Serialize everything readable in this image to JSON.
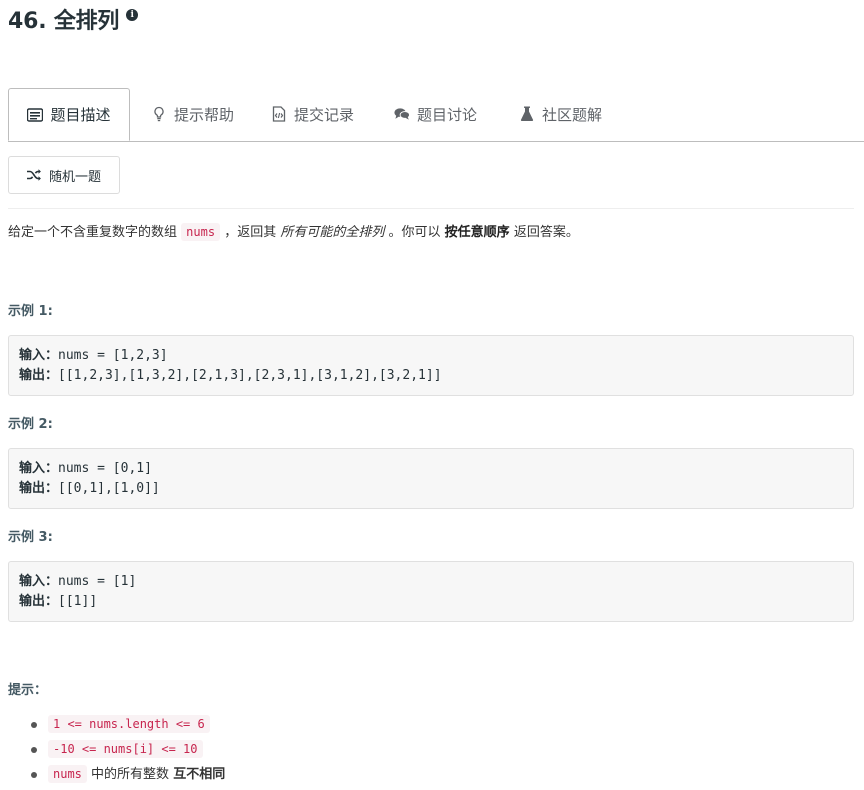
{
  "problem": {
    "title": "46. 全排列",
    "info_icon": "info-icon"
  },
  "tabs": [
    {
      "label": "题目描述",
      "icon": "description-icon",
      "active": true
    },
    {
      "label": "提示帮助",
      "icon": "lightbulb-icon",
      "active": false
    },
    {
      "label": "提交记录",
      "icon": "code-file-icon",
      "active": false
    },
    {
      "label": "题目讨论",
      "icon": "comments-icon",
      "active": false
    },
    {
      "label": "社区题解",
      "icon": "flask-icon",
      "active": false
    }
  ],
  "random_button": {
    "label": "随机一题",
    "icon": "shuffle-icon"
  },
  "description": {
    "part1": "给定一个不含重复数字的数组",
    "code": "nums",
    "part2": "，返回其",
    "emphasis": "所有可能的全排列",
    "part3": "。你可以",
    "bold": "按任意顺序",
    "part4": "返回答案。"
  },
  "examples": [
    {
      "label": "示例 1:",
      "input_key": "输入：",
      "input": "nums = [1,2,3]",
      "output_key": "输出：",
      "output": "[[1,2,3],[1,3,2],[2,1,3],[2,3,1],[3,1,2],[3,2,1]]"
    },
    {
      "label": "示例 2:",
      "input_key": "输入：",
      "input": "nums = [0,1]",
      "output_key": "输出：",
      "output": "[[0,1],[1,0]]"
    },
    {
      "label": "示例 3:",
      "input_key": "输入：",
      "input": "nums = [1]",
      "output_key": "输出：",
      "output": "[[1]]"
    }
  ],
  "tips": {
    "label": "提示：",
    "items": [
      {
        "code": "1 <= nums.length <= 6"
      },
      {
        "code": "-10 <= nums[i] <= 10"
      },
      {
        "code": "nums",
        "text": "中的所有整数",
        "bold": "互不相同"
      }
    ]
  }
}
